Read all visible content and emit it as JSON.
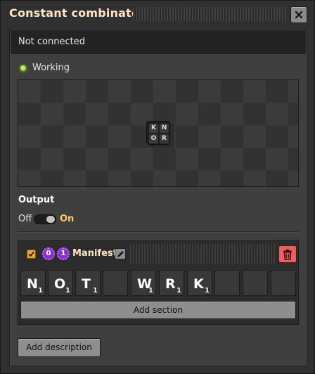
{
  "window": {
    "title": "Constant combinator"
  },
  "status": {
    "connection_text": "Not connected",
    "working_text": "Working",
    "working_color": "#9ee236"
  },
  "preview": {
    "entity_letters": [
      "K",
      "N",
      "O",
      "R"
    ]
  },
  "output": {
    "label": "Output",
    "off_label": "Off",
    "on_label": "On",
    "state": "On"
  },
  "section": {
    "checked": true,
    "badges": [
      "0",
      "1"
    ],
    "name": "Manifest",
    "slots": [
      {
        "letter": "N",
        "count": "1"
      },
      {
        "letter": "O",
        "count": "1"
      },
      {
        "letter": "T",
        "count": "1"
      },
      {
        "letter": "",
        "count": ""
      },
      {
        "letter": "W",
        "count": "1"
      },
      {
        "letter": "R",
        "count": "1"
      },
      {
        "letter": "K",
        "count": "1"
      },
      {
        "letter": "",
        "count": ""
      },
      {
        "letter": "",
        "count": ""
      },
      {
        "letter": "",
        "count": ""
      }
    ],
    "add_section_label": "Add section"
  },
  "footer": {
    "add_description_label": "Add description"
  },
  "icons": {
    "close": "close-icon",
    "edit": "pencil-icon",
    "delete": "trash-icon",
    "check": "check-icon"
  }
}
